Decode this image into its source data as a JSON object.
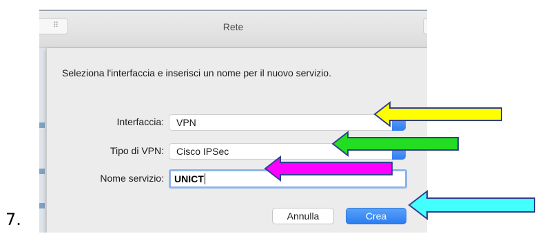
{
  "step_number": "7.",
  "window": {
    "title": "Rete",
    "grid_glyph": "⠿"
  },
  "dialog": {
    "description": "Seleziona l'interfaccia e inserisci un nome per il nuovo servizio.",
    "interface": {
      "label": "Interfaccia:",
      "value": "VPN"
    },
    "vpn_type": {
      "label": "Tipo di VPN:",
      "value": "Cisco IPSec"
    },
    "service_name": {
      "label": "Nome servizio:",
      "value": "UNICT"
    },
    "cancel_label": "Annulla",
    "create_label": "Crea"
  },
  "annotations": {
    "colors": {
      "yellow": "#ffff00",
      "green": "#22dd22",
      "magenta": "#ff00ff",
      "cyan": "#44ffff",
      "outline": "#2f3f8f"
    }
  },
  "colors": {
    "accent_blue": "#2f7df0",
    "focus_ring": "#8db5ec"
  }
}
